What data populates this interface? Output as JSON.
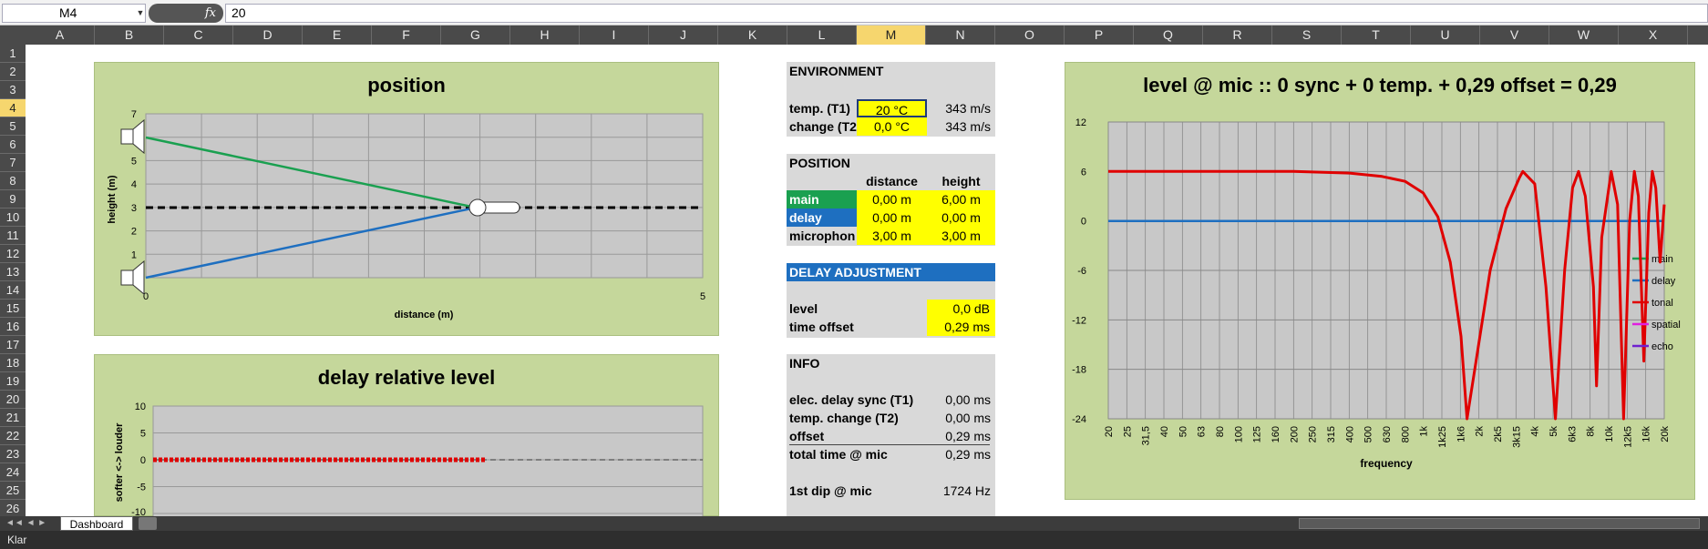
{
  "formula_bar": {
    "name_box": "M4",
    "fx_label": "fx",
    "value": "20"
  },
  "columns": [
    "A",
    "B",
    "C",
    "D",
    "E",
    "F",
    "G",
    "H",
    "I",
    "J",
    "K",
    "L",
    "M",
    "N",
    "O",
    "P",
    "Q",
    "R",
    "S",
    "T",
    "U",
    "V",
    "W",
    "X"
  ],
  "selected_column": "M",
  "rows": [
    "1",
    "2",
    "3",
    "4",
    "5",
    "6",
    "7",
    "8",
    "9",
    "10",
    "11",
    "12",
    "13",
    "14",
    "15",
    "16",
    "17",
    "18",
    "19",
    "20",
    "21",
    "22",
    "23",
    "24",
    "25",
    "26"
  ],
  "selected_row": "4",
  "position_chart": {
    "title": "position",
    "xlabel": "distance (m)",
    "ylabel": "height (m)",
    "y_ticks": [
      "7",
      "6",
      "5",
      "4",
      "3",
      "2",
      "1",
      "0"
    ],
    "x_ticks": [
      "0",
      "5"
    ],
    "colors": {
      "main": "#1aa050",
      "delay": "#1e6fc0",
      "axis": "#000000"
    }
  },
  "delay_chart": {
    "title": "delay relative level",
    "ylabel": "softer <-> louder",
    "y_ticks": [
      "10",
      "5",
      "0",
      "-5",
      "-10"
    ],
    "color": "#e00000"
  },
  "environment": {
    "header": "ENVIRONMENT",
    "temp_label": "temp. (T1)",
    "temp_value": "20 °C",
    "temp_speed": "343 m/s",
    "change_label": "change (T2",
    "change_value": "0,0 °C",
    "change_speed": "343 m/s"
  },
  "position": {
    "header": "POSITION",
    "col_distance": "distance",
    "col_height": "height",
    "rows": [
      {
        "label": "main",
        "distance": "0,00 m",
        "height": "6,00 m",
        "color": "#1aa050"
      },
      {
        "label": "delay",
        "distance": "0,00 m",
        "height": "0,00 m",
        "color": "#1e6fc0"
      },
      {
        "label": "microphon",
        "distance": "3,00 m",
        "height": "3,00 m",
        "color": ""
      }
    ]
  },
  "delay_adjustment": {
    "header": "DELAY ADJUSTMENT",
    "header_color": "#1e6fc0",
    "level_label": "level",
    "level_value": "0,0 dB",
    "offset_label": "time offset",
    "offset_value": "0,29 ms"
  },
  "info": {
    "header": "INFO",
    "rows": [
      {
        "label": "elec. delay sync (T1)",
        "value": "0,00 ms"
      },
      {
        "label": "temp. change (T2)",
        "value": "0,00 ms"
      },
      {
        "label": "offset",
        "value": "0,29 ms"
      },
      {
        "label": "total time @ mic",
        "value": "0,29 ms"
      },
      {
        "label": "1st dip @ mic",
        "value": "1724 Hz"
      }
    ]
  },
  "chart_data": {
    "type": "line",
    "title": "level @ mic :: 0 sync + 0 temp. + 0,29 offset = 0,29",
    "xlabel": "frequency",
    "ylabel": "",
    "categories": [
      "20",
      "25",
      "31,5",
      "40",
      "50",
      "63",
      "80",
      "100",
      "125",
      "160",
      "200",
      "250",
      "315",
      "400",
      "500",
      "630",
      "800",
      "1k",
      "1k25",
      "1k6",
      "2k",
      "2k5",
      "3k15",
      "4k",
      "5k",
      "6k3",
      "8k",
      "10k",
      "12k5",
      "16k",
      "20k"
    ],
    "y_ticks": [
      12,
      6,
      0,
      -6,
      -12,
      -18,
      -24
    ],
    "ylim": [
      -24,
      12
    ],
    "x_scale": "log",
    "series": [
      {
        "name": "main",
        "color": "#1aa050",
        "points": []
      },
      {
        "name": "delay",
        "color": "#1e6fc0",
        "points": [
          [
            20,
            0
          ],
          [
            20000,
            0
          ]
        ]
      },
      {
        "name": "tonal",
        "color": "#e00000",
        "points": [
          [
            20,
            6
          ],
          [
            200,
            6
          ],
          [
            400,
            5.8
          ],
          [
            600,
            5.4
          ],
          [
            800,
            4.8
          ],
          [
            1000,
            3.4
          ],
          [
            1200,
            0.5
          ],
          [
            1400,
            -5
          ],
          [
            1600,
            -14
          ],
          [
            1724,
            -24
          ],
          [
            1900,
            -18
          ],
          [
            2300,
            -6
          ],
          [
            2800,
            1.5
          ],
          [
            3300,
            5.2
          ],
          [
            3448,
            6
          ],
          [
            4000,
            4.5
          ],
          [
            4600,
            -8
          ],
          [
            5172,
            -24
          ],
          [
            5800,
            -6
          ],
          [
            6400,
            4
          ],
          [
            6897,
            6
          ],
          [
            7500,
            3
          ],
          [
            8300,
            -8
          ],
          [
            8621,
            -20
          ],
          [
            9200,
            -2
          ],
          [
            10345,
            6
          ],
          [
            11200,
            2
          ],
          [
            12069,
            -24
          ],
          [
            13000,
            0
          ],
          [
            13793,
            6
          ],
          [
            14500,
            3
          ],
          [
            15517,
            -17
          ],
          [
            16500,
            1
          ],
          [
            17241,
            6
          ],
          [
            18000,
            4
          ],
          [
            19000,
            -5
          ],
          [
            20000,
            2
          ]
        ]
      },
      {
        "name": "spatial",
        "color": "#e020e0",
        "points": []
      },
      {
        "name": "echo",
        "color": "#7020d0",
        "points": []
      }
    ],
    "legend_position": "right"
  },
  "sheet_tab": "Dashboard",
  "status": "Klar"
}
